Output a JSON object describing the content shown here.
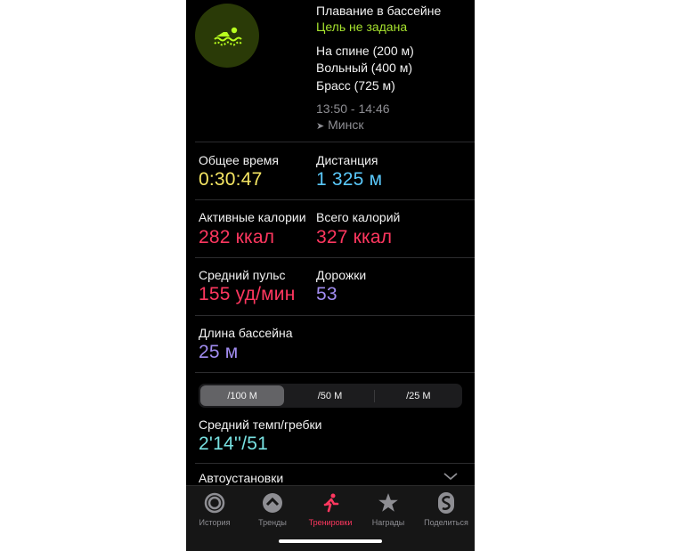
{
  "workout": {
    "title": "Плавание в бассейне",
    "goal": "Цель не задана",
    "strokes": [
      "На спине (200 м)",
      "Вольный (400 м)",
      "Брасс (725 м)"
    ],
    "time_range": "13:50 - 14:46",
    "location": "Минск"
  },
  "metrics": {
    "total_time_label": "Общее время",
    "total_time_value": "0:30:47",
    "distance_label": "Дистанция",
    "distance_value": "1 325 м",
    "active_cal_label": "Активные калории",
    "active_cal_value": "282 ккал",
    "total_cal_label": "Всего калорий",
    "total_cal_value": "327 ккал",
    "avg_hr_label": "Средний пульс",
    "avg_hr_value": "155 уд/мин",
    "lanes_label": "Дорожки",
    "lanes_value": "53",
    "pool_length_label": "Длина бассейна",
    "pool_length_value": "25 м"
  },
  "segments": {
    "options": [
      "/100 М",
      "/50 М",
      "/25 М"
    ],
    "selected": "/100 М"
  },
  "pace": {
    "label": "Средний темп/гребки",
    "value": "2'14''/51"
  },
  "autosets": {
    "label": "Автоустановки"
  },
  "tabbar": {
    "items": [
      "История",
      "Тренды",
      "Тренировки",
      "Награды",
      "Поделиться"
    ],
    "active": "Тренировки"
  },
  "colors": {
    "yellow": "#f5e663",
    "cyan": "#5ac8fa",
    "red": "#ff375f",
    "purple": "#a18cf0",
    "green": "#a6e22e",
    "teal": "#78e1e1"
  },
  "icons": {
    "workout": "swimmer-icon",
    "location": "location-arrow-icon",
    "chevron": "chevron-down-icon"
  }
}
